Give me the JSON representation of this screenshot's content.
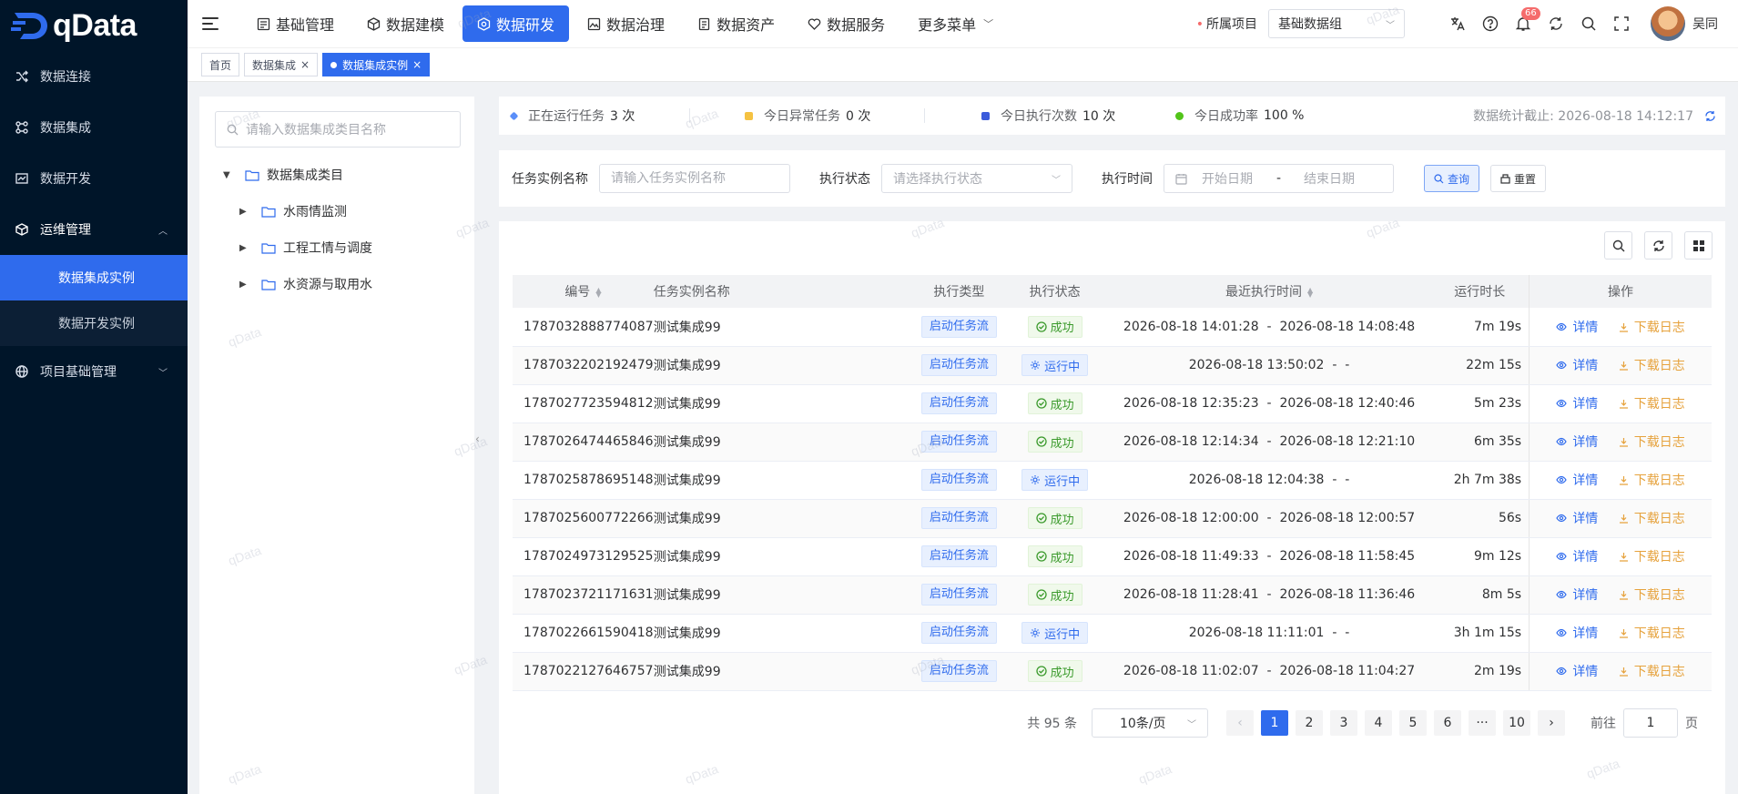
{
  "brand": {
    "name": "qData"
  },
  "sidebar": {
    "items": [
      {
        "label": "数据连接",
        "icon": "shuffle-icon"
      },
      {
        "label": "数据集成",
        "icon": "flow-icon"
      },
      {
        "label": "数据开发",
        "icon": "chart-icon"
      },
      {
        "label": "运维管理",
        "icon": "box-icon",
        "expanded": true,
        "children": [
          {
            "label": "数据集成实例",
            "active": true
          },
          {
            "label": "数据开发实例"
          }
        ]
      },
      {
        "label": "项目基础管理",
        "icon": "globe-icon"
      }
    ]
  },
  "topnav": {
    "tabs": [
      {
        "label": "基础管理"
      },
      {
        "label": "数据建模"
      },
      {
        "label": "数据研发",
        "active": true
      },
      {
        "label": "数据治理"
      },
      {
        "label": "数据资产"
      },
      {
        "label": "数据服务"
      },
      {
        "label": "更多菜单"
      }
    ],
    "project_label": "所属项目",
    "project_value": "基础数据组",
    "notification_count": "66",
    "user_name": "吴同"
  },
  "tags": [
    {
      "label": "首页"
    },
    {
      "label": "数据集成"
    },
    {
      "label": "数据集成实例",
      "active": true
    }
  ],
  "tree": {
    "search_placeholder": "请输入数据集成类目名称",
    "root": "数据集成类目",
    "children": [
      "水雨情监测",
      "工程工情与调度",
      "水资源与取用水"
    ]
  },
  "stats": {
    "running": {
      "label": "正在运行任务",
      "value": "3 次"
    },
    "abnormal": {
      "label": "今日异常任务",
      "value": "0 次"
    },
    "executions": {
      "label": "今日执行次数",
      "value": "10 次"
    },
    "success_rate": {
      "label": "今日成功率",
      "value": "100 %"
    },
    "updated": "数据统计截止: 2026-08-18 14:12:17"
  },
  "filter": {
    "name_label": "任务实例名称",
    "name_placeholder": "请输入任务实例名称",
    "status_label": "执行状态",
    "status_placeholder": "请选择执行状态",
    "time_label": "执行时间",
    "start_placeholder": "开始日期",
    "range_sep": "-",
    "end_placeholder": "结束日期",
    "query_label": "查询",
    "reset_label": "重置"
  },
  "table": {
    "columns": {
      "id": "编号",
      "name": "任务实例名称",
      "type": "执行类型",
      "status": "执行状态",
      "time": "最近执行时间",
      "duration": "运行时长",
      "ops": "操作"
    },
    "ops": {
      "detail": "详情",
      "log": "下载日志"
    },
    "rows": [
      {
        "id": "1787032888774087",
        "name": "测试集成99",
        "type": "启动任务流",
        "status": "成功",
        "state": "ok",
        "start": "2026-08-18 14:01:28",
        "end": "2026-08-18 14:08:48",
        "duration": "7m 19s"
      },
      {
        "id": "1787032202192479",
        "name": "测试集成99",
        "type": "启动任务流",
        "status": "运行中",
        "state": "run",
        "start": "2026-08-18 13:50:02",
        "end": "-",
        "duration": "22m 15s"
      },
      {
        "id": "1787027723594812",
        "name": "测试集成99",
        "type": "启动任务流",
        "status": "成功",
        "state": "ok",
        "start": "2026-08-18 12:35:23",
        "end": "2026-08-18 12:40:46",
        "duration": "5m 23s"
      },
      {
        "id": "1787026474465846",
        "name": "测试集成99",
        "type": "启动任务流",
        "status": "成功",
        "state": "ok",
        "start": "2026-08-18 12:14:34",
        "end": "2026-08-18 12:21:10",
        "duration": "6m 35s"
      },
      {
        "id": "1787025878695148",
        "name": "测试集成99",
        "type": "启动任务流",
        "status": "运行中",
        "state": "run",
        "start": "2026-08-18 12:04:38",
        "end": "-",
        "duration": "2h 7m 38s"
      },
      {
        "id": "1787025600772266",
        "name": "测试集成99",
        "type": "启动任务流",
        "status": "成功",
        "state": "ok",
        "start": "2026-08-18 12:00:00",
        "end": "2026-08-18 12:00:57",
        "duration": "56s"
      },
      {
        "id": "1787024973129525",
        "name": "测试集成99",
        "type": "启动任务流",
        "status": "成功",
        "state": "ok",
        "start": "2026-08-18 11:49:33",
        "end": "2026-08-18 11:58:45",
        "duration": "9m 12s"
      },
      {
        "id": "1787023721171631",
        "name": "测试集成99",
        "type": "启动任务流",
        "status": "成功",
        "state": "ok",
        "start": "2026-08-18 11:28:41",
        "end": "2026-08-18 11:36:46",
        "duration": "8m 5s"
      },
      {
        "id": "1787022661590418",
        "name": "测试集成99",
        "type": "启动任务流",
        "status": "运行中",
        "state": "run",
        "start": "2026-08-18 11:11:01",
        "end": "-",
        "duration": "3h 1m 15s"
      },
      {
        "id": "1787022127646757",
        "name": "测试集成99",
        "type": "启动任务流",
        "status": "成功",
        "state": "ok",
        "start": "2026-08-18 11:02:07",
        "end": "2026-08-18 11:04:27",
        "duration": "2m 19s"
      }
    ]
  },
  "pagination": {
    "total": "共 95 条",
    "page_size": "10条/页",
    "pages": [
      "1",
      "2",
      "3",
      "4",
      "5",
      "6",
      "···",
      "10"
    ],
    "current": "1",
    "goto_label": "前往",
    "goto_value": "1",
    "goto_suffix": "页"
  },
  "watermark": "qData",
  "colors": {
    "primary": "#2f6bed",
    "sidebar": "#001529",
    "success": "#3a9a2b",
    "warning": "#e6a23c",
    "danger": "#f56c6c"
  }
}
